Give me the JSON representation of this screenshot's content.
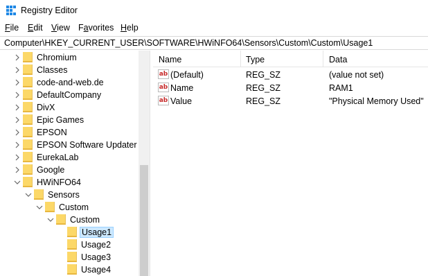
{
  "window": {
    "title": "Registry Editor",
    "icon": "registry-editor-icon"
  },
  "menu": [
    {
      "label": "File",
      "mnemonic": "F",
      "rest": "ile"
    },
    {
      "label": "Edit",
      "mnemonic": "E",
      "rest": "dit"
    },
    {
      "label": "View",
      "mnemonic": "V",
      "rest": "iew"
    },
    {
      "label": "Favorites",
      "mnemonic": "a",
      "pre": "F",
      "rest": "vorites"
    },
    {
      "label": "Help",
      "mnemonic": "H",
      "rest": "elp"
    }
  ],
  "address": "Computer\\HKEY_CURRENT_USER\\SOFTWARE\\HWiNFO64\\Sensors\\Custom\\Custom\\Usage1",
  "tree": [
    {
      "label": "Chromium",
      "depth": 0,
      "state": "collapsed"
    },
    {
      "label": "Classes",
      "depth": 0,
      "state": "collapsed"
    },
    {
      "label": "code-and-web.de",
      "depth": 0,
      "state": "collapsed"
    },
    {
      "label": "DefaultCompany",
      "depth": 0,
      "state": "collapsed"
    },
    {
      "label": "DivX",
      "depth": 0,
      "state": "collapsed"
    },
    {
      "label": "Epic Games",
      "depth": 0,
      "state": "collapsed"
    },
    {
      "label": "EPSON",
      "depth": 0,
      "state": "collapsed"
    },
    {
      "label": "EPSON Software Updater",
      "depth": 0,
      "state": "collapsed"
    },
    {
      "label": "EurekaLab",
      "depth": 0,
      "state": "collapsed"
    },
    {
      "label": "Google",
      "depth": 0,
      "state": "collapsed"
    },
    {
      "label": "HWiNFO64",
      "depth": 0,
      "state": "expanded"
    },
    {
      "label": "Sensors",
      "depth": 1,
      "state": "expanded"
    },
    {
      "label": "Custom",
      "depth": 2,
      "state": "expanded"
    },
    {
      "label": "Custom",
      "depth": 3,
      "state": "expanded"
    },
    {
      "label": "Usage1",
      "depth": 4,
      "state": "leaf",
      "selected": true
    },
    {
      "label": "Usage2",
      "depth": 4,
      "state": "leaf"
    },
    {
      "label": "Usage3",
      "depth": 4,
      "state": "leaf"
    },
    {
      "label": "Usage4",
      "depth": 4,
      "state": "leaf"
    }
  ],
  "list": {
    "columns": [
      "Name",
      "Type",
      "Data"
    ],
    "rows": [
      {
        "name": "(Default)",
        "type": "REG_SZ",
        "data": "(value not set)",
        "icon": "string-value-icon"
      },
      {
        "name": "Name",
        "type": "REG_SZ",
        "data": "RAM1",
        "icon": "string-value-icon"
      },
      {
        "name": "Value",
        "type": "REG_SZ",
        "data": "\"Physical Memory Used\"",
        "icon": "string-value-icon"
      }
    ]
  },
  "colors": {
    "folder": "#fcd868",
    "selection": "#cce8ff",
    "selection_border": "#99d1ff"
  }
}
